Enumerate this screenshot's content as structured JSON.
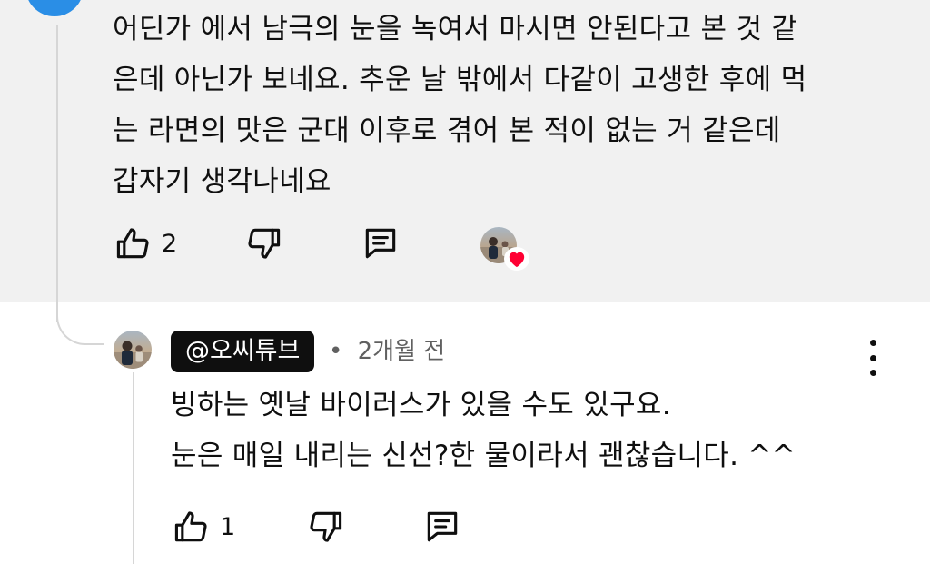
{
  "parent_comment": {
    "text": "어딘가 에서 남극의 눈을 녹여서 마시면 안된다고 본 것 같\n은데 아닌가 보네요. 추운 날 밖에서 다같이 고생한 후에 먹\n는 라면의 맛은 군대 이후로 겪어 본 적이 없는 거 같은데\n갑자기 생각나네요",
    "like_count": "2",
    "icons": {
      "like": "thumbs-up-icon",
      "dislike": "thumbs-down-icon",
      "reply": "comment-icon",
      "creator_heart": "heart-icon"
    },
    "colors": {
      "background": "#f1f1f1",
      "avatar": "#2a8ee6",
      "heart": "#ff0033"
    }
  },
  "reply_comment": {
    "author": "@오씨튜브",
    "separator": "•",
    "time": "2개월 전",
    "text": "빙하는 옛날 바이러스가 있을 수도 있구요.\n눈은 매일 내리는 신선?한 물이라서 괜찮습니다. ^^",
    "like_count": "1",
    "icons": {
      "like": "thumbs-up-icon",
      "dislike": "thumbs-down-icon",
      "reply": "comment-icon",
      "more": "more-vertical-icon"
    },
    "colors": {
      "author_badge_bg": "#0f0f0f",
      "author_badge_text": "#ffffff",
      "meta_text": "#606060"
    }
  }
}
